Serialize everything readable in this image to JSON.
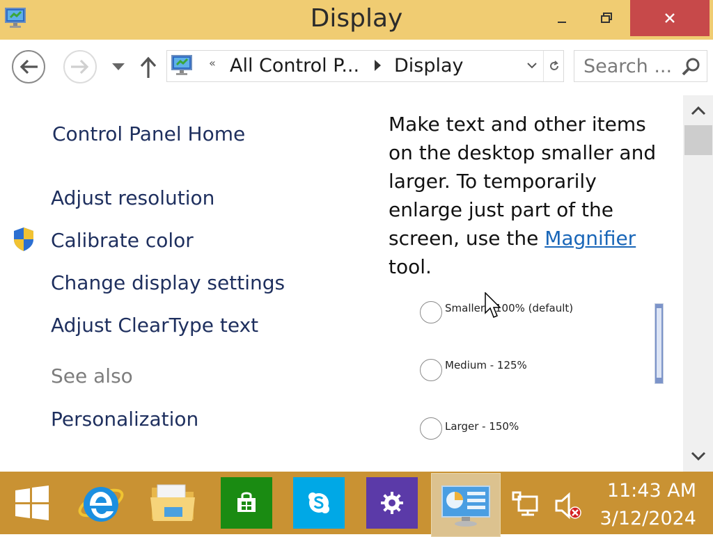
{
  "window": {
    "title": "Display"
  },
  "nav": {
    "address_segments": [
      "All Control P...",
      "Display"
    ],
    "address_prefix": "«",
    "search_placeholder": "Search ..."
  },
  "left_pane": {
    "home": "Control Panel Home",
    "links": [
      "Adjust resolution",
      "Calibrate color",
      "Change display settings",
      "Adjust ClearType text"
    ],
    "see_also_heading": "See also",
    "see_also_links": [
      "Personalization"
    ]
  },
  "content": {
    "desc_before": "Make text and other items on the desktop smaller and larger. To temporarily enlarge just part of the screen, use the ",
    "desc_link": "Magnifier",
    "desc_after": " tool.",
    "options": [
      "Smaller - 100% (default)",
      "Medium - 125%",
      "Larger - 150%"
    ]
  },
  "taskbar": {
    "apps": [
      "start",
      "internet-explorer",
      "file-explorer",
      "store",
      "skype",
      "settings",
      "control-panel"
    ],
    "time": "11:43 AM",
    "date": "3/12/2024"
  },
  "colors": {
    "titlebar": "#f0cc72",
    "close": "#c7494a",
    "taskbar": "#c99233",
    "link": "#1966b8",
    "nav_link": "#1e2f5e"
  }
}
